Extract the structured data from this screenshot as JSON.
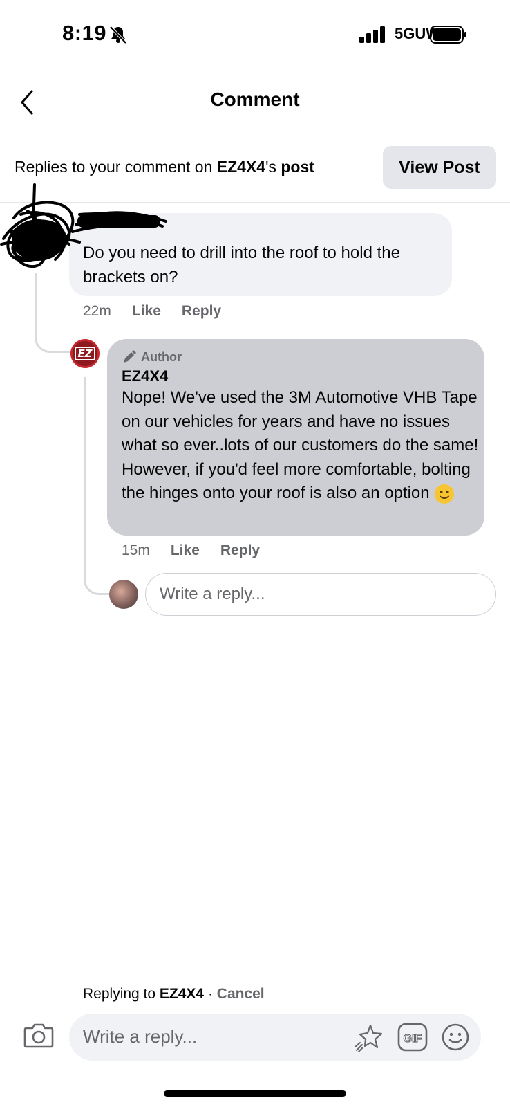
{
  "status_bar": {
    "time": "8:19",
    "network": "5GUW",
    "icons": [
      "bell-slash-icon",
      "cellular-signal-icon",
      "battery-icon"
    ]
  },
  "header": {
    "title": "Comment",
    "back_icon": "chevron-left-icon"
  },
  "context_bar": {
    "prefix": "Replies to your comment on ",
    "page_name": "EZ4X4",
    "suffix": "'s ",
    "post_word": "post",
    "view_post_label": "View Post"
  },
  "comments": [
    {
      "text": "Do you need to drill into the roof to hold the brackets on?",
      "time": "22m",
      "like_label": "Like",
      "reply_label": "Reply"
    },
    {
      "badge": "Author",
      "author_name": "EZ4X4",
      "avatar_text": "EZ",
      "text": "Nope! We've used the 3M Automotive VHB Tape on our vehicles for years and have no issues what so ever..lots of our customers do the same! However, if you'd feel more comfortable, bolting the hinges onto your roof is also an option",
      "emoji": "slightly-smiling-face-icon",
      "time": "15m",
      "like_label": "Like",
      "reply_label": "Reply"
    }
  ],
  "inline_reply": {
    "placeholder": "Write a reply..."
  },
  "composer": {
    "replying_prefix": "Replying to ",
    "replying_to": "EZ4X4",
    "separator": " · ",
    "cancel_label": "Cancel",
    "placeholder": "Write a reply...",
    "gif_label": "GIF",
    "icons": [
      "camera-icon",
      "avatar-sticker-icon",
      "gif-icon",
      "smiley-icon"
    ]
  },
  "colors": {
    "secondary_text": "#65676b",
    "bubble": "#f0f2f5",
    "author_bubble": "#ccced3",
    "button_bg": "#e4e6eb"
  }
}
